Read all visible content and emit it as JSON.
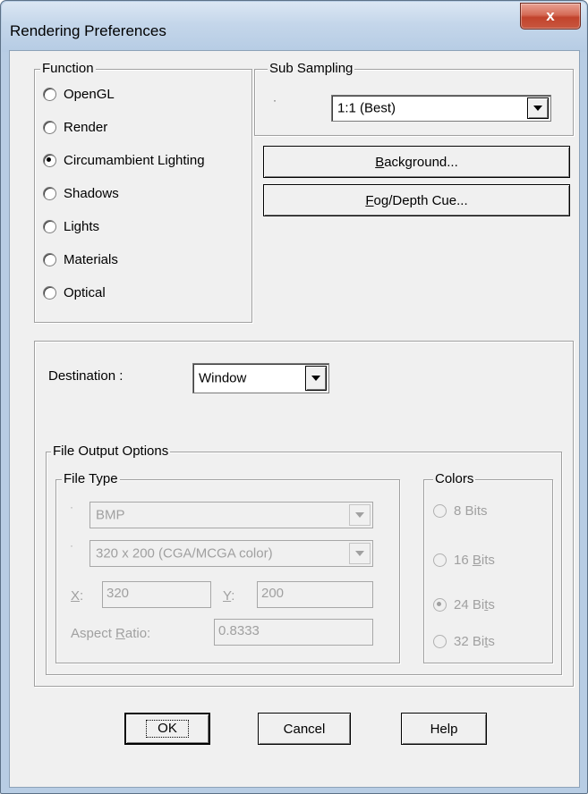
{
  "window": {
    "title": "Rendering Preferences",
    "close_glyph": "x"
  },
  "function_group": {
    "legend": "Function",
    "options": [
      {
        "label": "OpenGL",
        "selected": false
      },
      {
        "label": "Render",
        "selected": false
      },
      {
        "label": "Circumambient Lighting",
        "selected": true
      },
      {
        "label": "Shadows",
        "selected": false
      },
      {
        "label": "Lights",
        "selected": false
      },
      {
        "label": "Materials",
        "selected": false
      },
      {
        "label": "Optical",
        "selected": false
      }
    ]
  },
  "sub_sampling": {
    "legend": "Sub Sampling",
    "bullet": "·",
    "value": "1:1 (Best)"
  },
  "buttons": {
    "background_pre": "",
    "background_key": "B",
    "background_rest": "ackground...",
    "fog_key": "F",
    "fog_rest": "og/Depth Cue...",
    "ok": "OK",
    "cancel": "Cancel",
    "help": "Help"
  },
  "destination": {
    "label": "Destination :",
    "value": "Window"
  },
  "file_output": {
    "legend": "File Output Options",
    "file_type": {
      "legend": "File Type",
      "bullet": "·",
      "format_value": "BMP",
      "resolution_value": "320 x 200 (CGA/MCGA color)",
      "x_key": "X",
      "x_rest": ":",
      "x_value": "320",
      "y_key": "Y",
      "y_rest": ":",
      "y_value": "200",
      "aspect_pre": "Aspect ",
      "aspect_key": "R",
      "aspect_rest": "atio:",
      "aspect_value": "0.8333"
    },
    "colors": {
      "legend": "Colors",
      "options": [
        {
          "label_pre": "8 Bits",
          "key": "",
          "label_post": "",
          "selected": false
        },
        {
          "label_pre": "16 ",
          "key": "B",
          "label_post": "its",
          "selected": false
        },
        {
          "label_pre": "24 Bi",
          "key": "t",
          "label_post": "s",
          "selected": true
        },
        {
          "label_pre": "32 Bi",
          "key": "t",
          "label_post": "s",
          "selected": false
        }
      ]
    }
  }
}
